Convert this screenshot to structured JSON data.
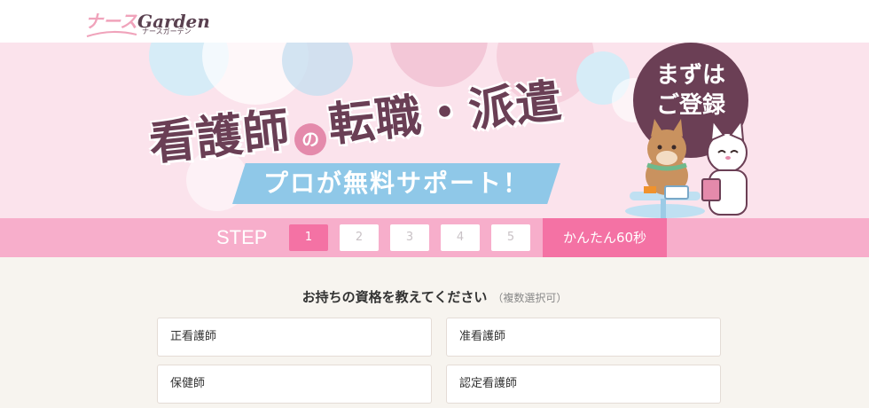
{
  "header": {
    "logo_kana": "ナース",
    "logo_en": "Garden",
    "logo_sub": "ナースガーデン"
  },
  "hero": {
    "title_part1": "看護師",
    "title_no": "の",
    "title_part2": "転職・派遣",
    "banner": "プロが無料サポート！",
    "badge_line1": "まずは",
    "badge_line2": "ご登録"
  },
  "steps": {
    "label": "STEP",
    "items": [
      "1",
      "2",
      "3",
      "4",
      "5"
    ],
    "active": 1,
    "quick_label": "かんたん60秒"
  },
  "question": {
    "title": "お持ちの資格を教えてください",
    "hint": "（複数選択可）",
    "options": [
      "正看護師",
      "准看護師",
      "保健師",
      "認定看護師"
    ]
  },
  "colors": {
    "accent_pink": "#f472a4",
    "step_bar": "#f7aecb",
    "hero_bg": "#fbe3ec",
    "title_plum": "#6a3f55",
    "banner_blue": "#8fc8e8"
  }
}
